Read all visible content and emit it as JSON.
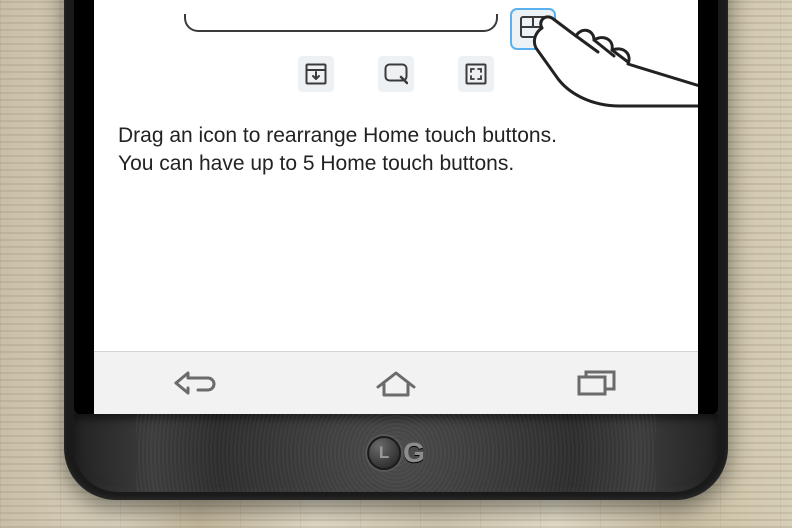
{
  "instructions": {
    "line1": "Drag an icon to rearrange Home touch buttons.",
    "line2": "You can have up to 5 Home touch buttons."
  },
  "highlighted_option": "dual-window-icon",
  "option_icons": [
    "notification-pulldown-icon",
    "qmemo-icon",
    "qslide-icon"
  ],
  "nav": {
    "back": "back-icon",
    "home": "home-icon",
    "recent": "recent-apps-icon"
  },
  "device_brand": "LG"
}
